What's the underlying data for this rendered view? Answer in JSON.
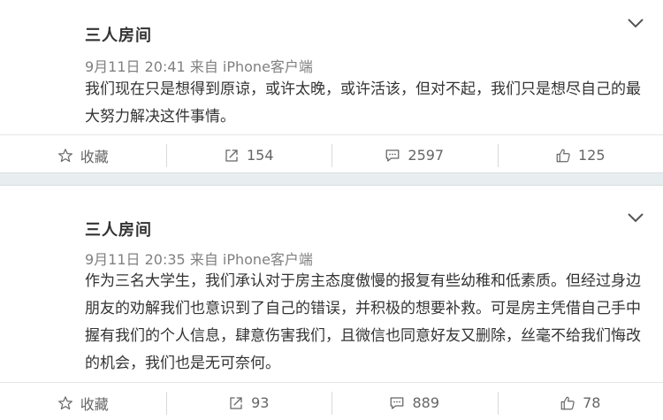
{
  "posts": [
    {
      "username": "三人房间",
      "meta": "9月11日 20:41 来自 iPhone客户端",
      "content": "我们现在只是想得到原谅，或许太晚，或许活该，但对不起，我们只是想尽自己的最大努力解决这件事情。",
      "actions": {
        "favorite": "收藏",
        "reposts": "154",
        "comments": "2597",
        "likes": "125"
      }
    },
    {
      "username": "三人房间",
      "meta": "9月11日 20:35 来自 iPhone客户端",
      "content": "作为三名大学生，我们承认对于房主态度傲慢的报复有些幼稚和低素质。但经过身边朋友的劝解我们也意识到了自己的错误，并积极的想要补救。可是房主凭借自己手中握有我们的个人信息，肆意伤害我们，且微信也同意好友又删除，丝毫不给我们悔改的机会，我们也是无可奈何。",
      "actions": {
        "favorite": "收藏",
        "reposts": "93",
        "comments": "889",
        "likes": "78"
      }
    }
  ],
  "icons": {
    "favorite": "star-outline-icon",
    "repost": "share-arrow-icon",
    "comment": "comment-bubble-icon",
    "like": "thumbs-up-icon",
    "menu": "chevron-down-icon"
  }
}
